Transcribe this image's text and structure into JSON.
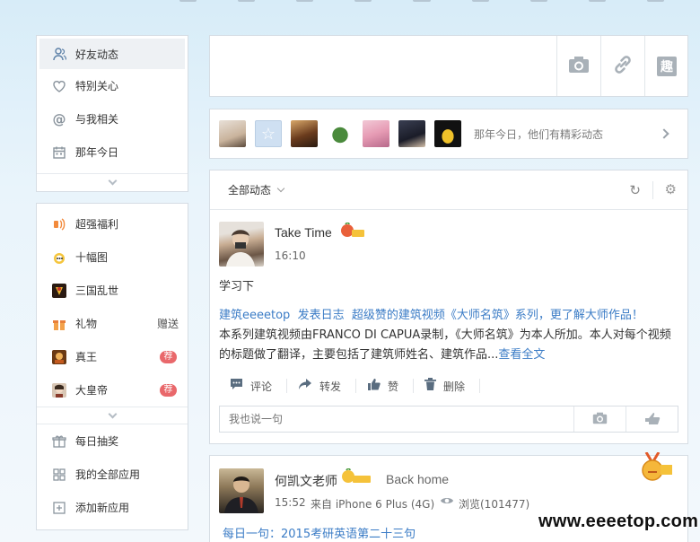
{
  "sidebar_top": {
    "items": [
      {
        "label": "好友动态",
        "icon": "friends-icon"
      },
      {
        "label": "特别关心",
        "icon": "heart-icon"
      },
      {
        "label": "与我相关",
        "icon": "at-icon"
      },
      {
        "label": "那年今日",
        "icon": "calendar-icon"
      }
    ]
  },
  "sidebar_apps": {
    "items": [
      {
        "label": "超强福利",
        "icon": "gift-sound-icon"
      },
      {
        "label": "十幅图",
        "icon": "pictures-icon"
      },
      {
        "label": "三国乱世",
        "icon": "game-icon"
      },
      {
        "label": "礼物",
        "icon": "present-icon",
        "right": "赠送"
      },
      {
        "label": "真王",
        "icon": "game-icon",
        "badge": "荐"
      },
      {
        "label": "大皇帝",
        "icon": "game-icon",
        "badge": "荐"
      }
    ],
    "bottom": [
      {
        "label": "每日抽奖",
        "icon": "lottery-icon"
      },
      {
        "label": "我的全部应用",
        "icon": "grid-icon"
      },
      {
        "label": "添加新应用",
        "icon": "add-icon"
      }
    ]
  },
  "publisher": {
    "qu_label": "趣"
  },
  "history": {
    "text": "那年今日，他们有精彩动态"
  },
  "feed": {
    "filter_label": "全部动态",
    "post1": {
      "name": "Take Time",
      "time": "16:10",
      "text": "学习下",
      "share_source": "建筑eeeetop",
      "share_action": "发表日志",
      "share_title": "超级赞的建筑视频《大师名筑》系列，更了解大师作品！",
      "share_body": "本系列建筑视频由FRANCO DI CAPUA录制，《大师名筑》为本人所加。本人对每个视频的标题做了翻译，主要包括了建筑师姓名、建筑作品...",
      "share_more": "查看全文",
      "actions": {
        "comment": "评论",
        "forward": "转发",
        "like": "赞",
        "delete": "删除"
      },
      "comment_placeholder": "我也说一句"
    },
    "post2": {
      "name": "何凯文老师",
      "status": "Back home",
      "time": "15:52",
      "from": "来自 iPhone 6 Plus (4G)",
      "views": "浏览(101477)",
      "text": "每日一句：2015考研英语第二十三句"
    }
  },
  "watermark": "www.eeeetop.com",
  "colors": {
    "link": "#3b7cc6",
    "badge": "#e9686b",
    "border": "#d6dde4"
  }
}
